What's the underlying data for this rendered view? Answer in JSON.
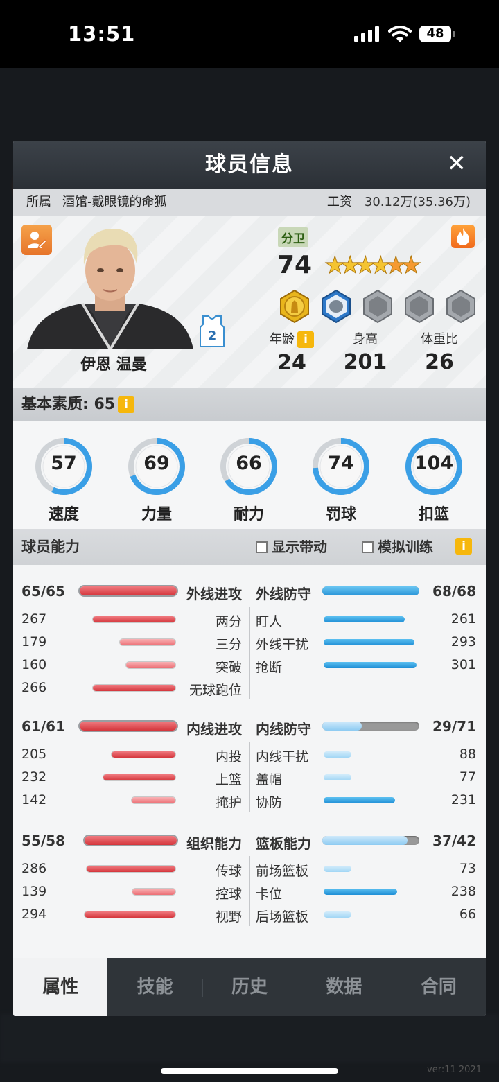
{
  "status_bar": {
    "time": "13:51",
    "battery": "48"
  },
  "footer": {
    "version": "ver:11  2021"
  },
  "modal": {
    "title": "球员信息",
    "close": "✕"
  },
  "club": {
    "label": "所属",
    "value": "酒馆-戴眼镜的命狐",
    "salary_label": "工资",
    "salary_value": "30.12万(35.36万)"
  },
  "player": {
    "name": "伊恩 温曼",
    "position": "分卫",
    "rating": "74",
    "jersey_number": "2",
    "stars": 6,
    "orange_stars": 2,
    "age_label": "年龄",
    "age": "24",
    "height_label": "身高",
    "height": "201",
    "weight_label": "体重比",
    "weight": "26",
    "info_icon": "i"
  },
  "basic": {
    "label": "基本素质: 65",
    "info_icon": "i"
  },
  "attributes": [
    {
      "label": "速度",
      "value": "57",
      "fill": 0.57
    },
    {
      "label": "力量",
      "value": "69",
      "fill": 0.69
    },
    {
      "label": "耐力",
      "value": "66",
      "fill": 0.66
    },
    {
      "label": "罚球",
      "value": "74",
      "fill": 0.74
    },
    {
      "label": "扣篮",
      "value": "104",
      "fill": 1.0
    }
  ],
  "abilities": {
    "title": "球员能力",
    "show_boost": "显示带动",
    "sim_training": "模拟训练",
    "info_icon": "i"
  },
  "groups": [
    {
      "left_title": "外线进攻",
      "left_value": "65/65",
      "left_fill": 1.0,
      "right_title": "外线防守",
      "right_value": "68/68",
      "right_fill": 1.0,
      "left_rows": [
        {
          "label": "两分",
          "value": "267"
        },
        {
          "label": "三分",
          "value": "179"
        },
        {
          "label": "突破",
          "value": "160"
        },
        {
          "label": "无球跑位",
          "value": "266"
        }
      ],
      "right_rows": [
        {
          "label": "盯人",
          "value": "261"
        },
        {
          "label": "外线干扰",
          "value": "293"
        },
        {
          "label": "抢断",
          "value": "301"
        }
      ]
    },
    {
      "left_title": "内线进攻",
      "left_value": "61/61",
      "left_fill": 1.0,
      "right_title": "内线防守",
      "right_value": "29/71",
      "right_fill": 0.41,
      "left_rows": [
        {
          "label": "内投",
          "value": "205"
        },
        {
          "label": "上篮",
          "value": "232"
        },
        {
          "label": "掩护",
          "value": "142"
        }
      ],
      "right_rows": [
        {
          "label": "内线干扰",
          "value": "88"
        },
        {
          "label": "盖帽",
          "value": "77"
        },
        {
          "label": "协防",
          "value": "231"
        }
      ]
    },
    {
      "left_title": "组织能力",
      "left_value": "55/58",
      "left_fill": 0.95,
      "right_title": "篮板能力",
      "right_value": "37/42",
      "right_fill": 0.88,
      "left_rows": [
        {
          "label": "传球",
          "value": "286"
        },
        {
          "label": "控球",
          "value": "139"
        },
        {
          "label": "视野",
          "value": "294"
        }
      ],
      "right_rows": [
        {
          "label": "前场篮板",
          "value": "73"
        },
        {
          "label": "卡位",
          "value": "238"
        },
        {
          "label": "后场篮板",
          "value": "66"
        }
      ]
    }
  ],
  "tabs": [
    {
      "label": "属性",
      "active": true
    },
    {
      "label": "技能"
    },
    {
      "label": "历史"
    },
    {
      "label": "数据"
    },
    {
      "label": "合同"
    }
  ],
  "colors": {
    "red_bar": "#d4363c",
    "blue_bar": "#1f8fd6",
    "accent_orange": "#f08a2a",
    "info_yellow": "#f6b70c"
  }
}
